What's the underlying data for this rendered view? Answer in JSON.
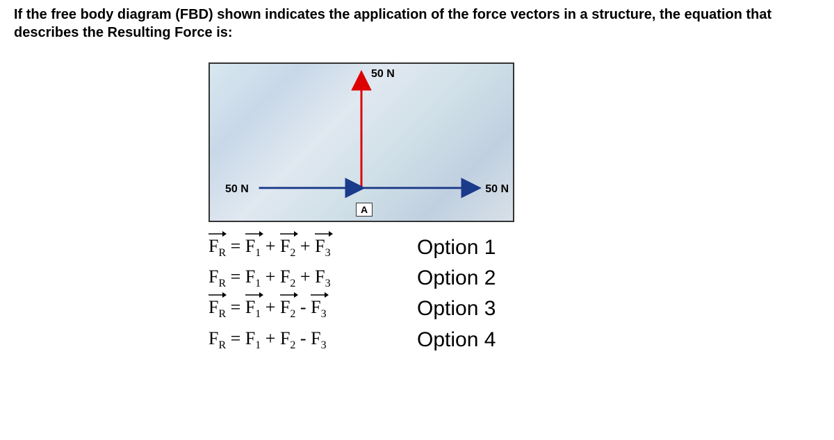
{
  "question": {
    "text": "If the free body diagram (FBD) shown indicates the application of the force vectors in a structure, the equation that describes the Resulting Force is:"
  },
  "diagram": {
    "force_top": "50 N",
    "force_left": "50 N",
    "force_right": "50 N",
    "point_label": "A"
  },
  "options": {
    "opt1": {
      "fr": "F",
      "fr_sub": "R",
      "eq": " = ",
      "f1": "F",
      "f1_sub": "1",
      "plus1": " + ",
      "f2": "F",
      "f2_sub": "2",
      "plus2": " + ",
      "f3": "F",
      "f3_sub": "3",
      "label": "Option 1",
      "has_vectors": true
    },
    "opt2": {
      "fr": "F",
      "fr_sub": "R",
      "eq": " = ",
      "f1": "F",
      "f1_sub": "1",
      "plus1": " + ",
      "f2": "F",
      "f2_sub": "2",
      "plus2": " + ",
      "f3": "F",
      "f3_sub": "3",
      "label": "Option 2",
      "has_vectors": false
    },
    "opt3": {
      "fr": "F",
      "fr_sub": "R",
      "eq": " = ",
      "f1": "F",
      "f1_sub": "1",
      "plus1": " + ",
      "f2": "F",
      "f2_sub": "2",
      "plus2": " - ",
      "f3": "F",
      "f3_sub": "3",
      "label": "Option 3",
      "has_vectors": true
    },
    "opt4": {
      "fr": "F",
      "fr_sub": "R",
      "eq": " = ",
      "f1": "F",
      "f1_sub": "1",
      "plus1": " + ",
      "f2": "F",
      "f2_sub": "2",
      "plus2": " - ",
      "f3": "F",
      "f3_sub": "3",
      "label": "Option 4",
      "has_vectors": false
    }
  }
}
